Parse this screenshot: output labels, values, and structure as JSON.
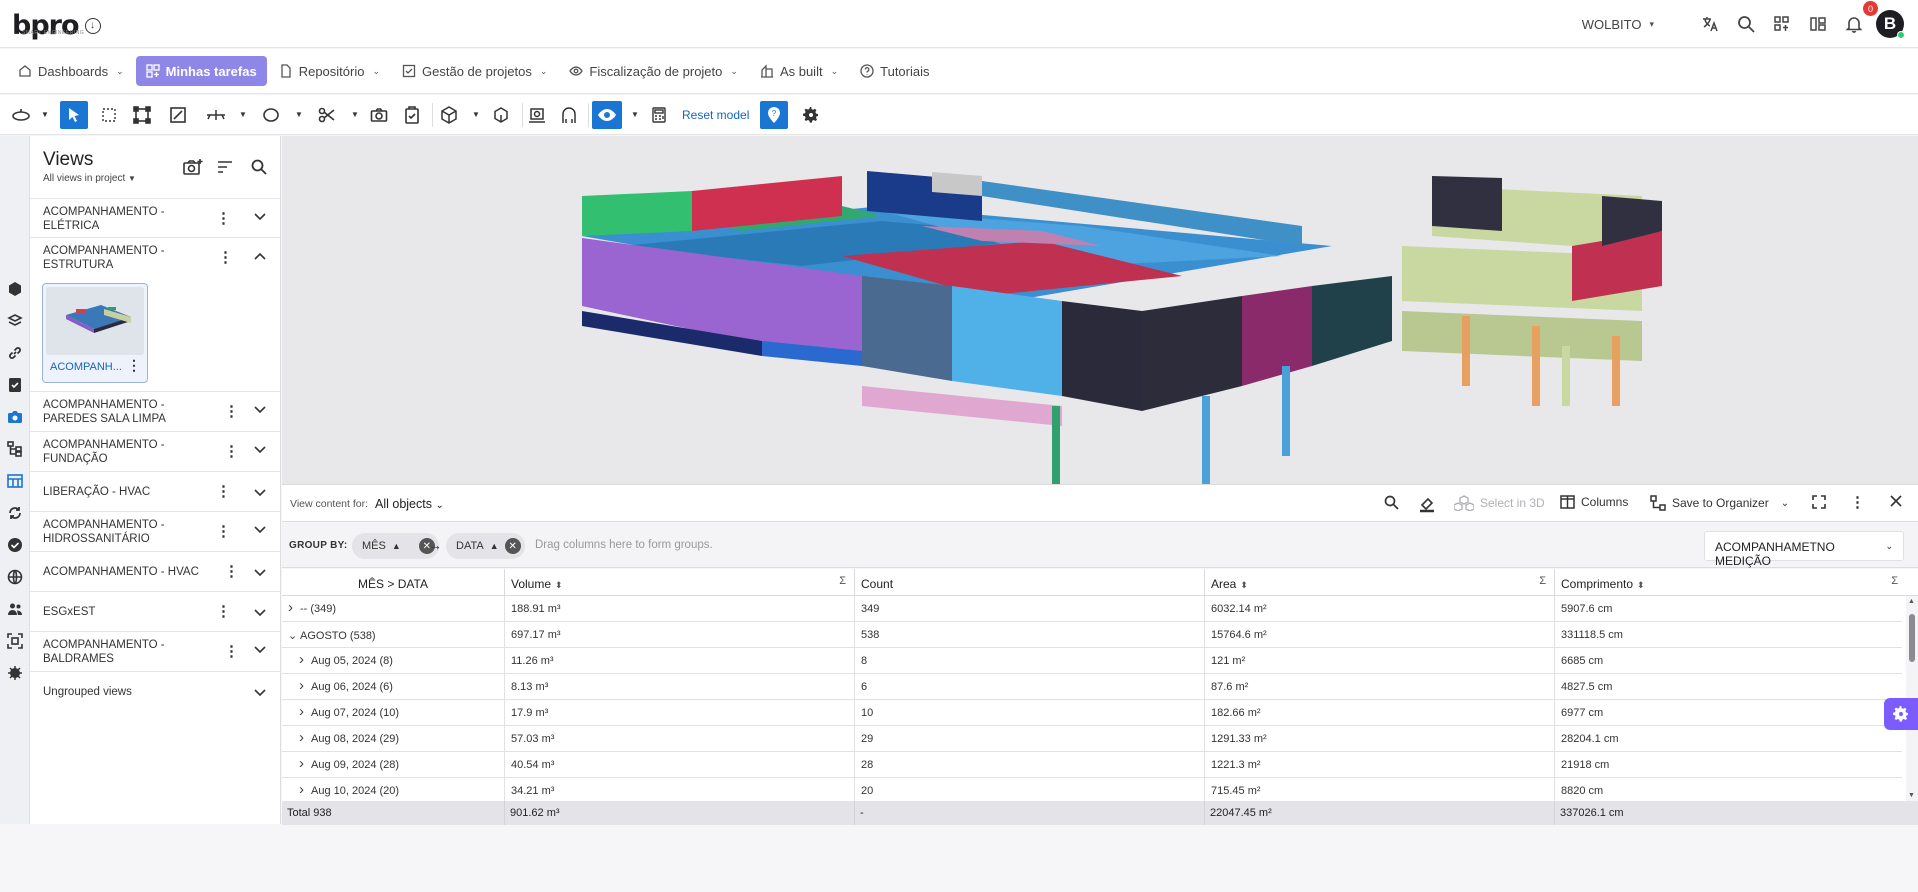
{
  "header": {
    "logo_text": "bpro",
    "logo_subtext": "SMART ENGINEERING",
    "org_name": "WOLBITO",
    "notification_count": "0",
    "avatar_initial": "B"
  },
  "menu": {
    "items": [
      {
        "label": "Dashboards"
      },
      {
        "label": "Minhas tarefas"
      },
      {
        "label": "Repositório"
      },
      {
        "label": "Gestão de projetos"
      },
      {
        "label": "Fiscalização de projeto"
      },
      {
        "label": "As built"
      },
      {
        "label": "Tutoriais"
      }
    ]
  },
  "toolbar": {
    "reset_label": "Reset model"
  },
  "sidebar": {
    "title": "Views",
    "subtitle": "All views in project",
    "groups": [
      {
        "label": "ACOMPANHAMENTO - ELÉTRICA"
      },
      {
        "label": "ACOMPANHAMENTO - ESTRUTURA"
      },
      {
        "label": "ACOMPANHAMENTO - PAREDES SALA LIMPA"
      },
      {
        "label": "ACOMPANHAMENTO - FUNDAÇÃO"
      },
      {
        "label": "LIBERAÇÃO - HVAC"
      },
      {
        "label": "ACOMPANHAMENTO - HIDROSSANITÁRIO"
      },
      {
        "label": "ACOMPANHAMENTO - HVAC"
      },
      {
        "label": "ESGxEST"
      },
      {
        "label": "ACOMPANHAMENTO - BALDRAMES"
      },
      {
        "label": "Ungrouped views"
      }
    ],
    "thumbnail_label": "ACOMPANH..."
  },
  "content": {
    "view_for_label": "View content for:",
    "view_for_value": "All objects",
    "select_3d": "Select in 3D",
    "columns": "Columns",
    "save_organizer": "Save to Organizer",
    "group_by_label": "GROUP BY:",
    "group_chips": [
      "MÊS",
      "DATA"
    ],
    "group_hint": "Drag columns here to form groups.",
    "preset": "ACOMPANHAMETNO MEDIÇÃO"
  },
  "table": {
    "columns": [
      "MÊS > DATA",
      "Volume",
      "Count",
      "Area",
      "Comprimento"
    ],
    "rows": [
      {
        "label": "-- (349)",
        "volume": "188.91 m³",
        "count": "349",
        "area": "6032.14 m²",
        "comprimento": "5907.6 cm",
        "level": 0,
        "expanded": false
      },
      {
        "label": "AGOSTO (538)",
        "volume": "697.17 m³",
        "count": "538",
        "area": "15764.6 m²",
        "comprimento": "331118.5 cm",
        "level": 0,
        "expanded": true
      },
      {
        "label": "Aug 05, 2024 (8)",
        "volume": "11.26 m³",
        "count": "8",
        "area": "121 m²",
        "comprimento": "6685 cm",
        "level": 1,
        "expanded": false
      },
      {
        "label": "Aug 06, 2024 (6)",
        "volume": "8.13 m³",
        "count": "6",
        "area": "87.6 m²",
        "comprimento": "4827.5 cm",
        "level": 1,
        "expanded": false
      },
      {
        "label": "Aug 07, 2024 (10)",
        "volume": "17.9 m³",
        "count": "10",
        "area": "182.66 m²",
        "comprimento": "6977 cm",
        "level": 1,
        "expanded": false
      },
      {
        "label": "Aug 08, 2024 (29)",
        "volume": "57.03 m³",
        "count": "29",
        "area": "1291.33 m²",
        "comprimento": "28204.1 cm",
        "level": 1,
        "expanded": false
      },
      {
        "label": "Aug 09, 2024 (28)",
        "volume": "40.54 m³",
        "count": "28",
        "area": "1221.3 m²",
        "comprimento": "21918 cm",
        "level": 1,
        "expanded": false
      },
      {
        "label": "Aug 10, 2024 (20)",
        "volume": "34.21 m³",
        "count": "20",
        "area": "715.45 m²",
        "comprimento": "8820 cm",
        "level": 1,
        "expanded": false
      }
    ],
    "total": {
      "label": "Total 938",
      "volume": "901.62 m³",
      "count": "-",
      "area": "22047.45 m²",
      "comprimento": "337026.1 cm"
    }
  },
  "colors": {
    "accent": "#1976d2",
    "active_menu": "#8f87e8",
    "settings_fab": "#7c5cff",
    "badge": "#e53935"
  }
}
